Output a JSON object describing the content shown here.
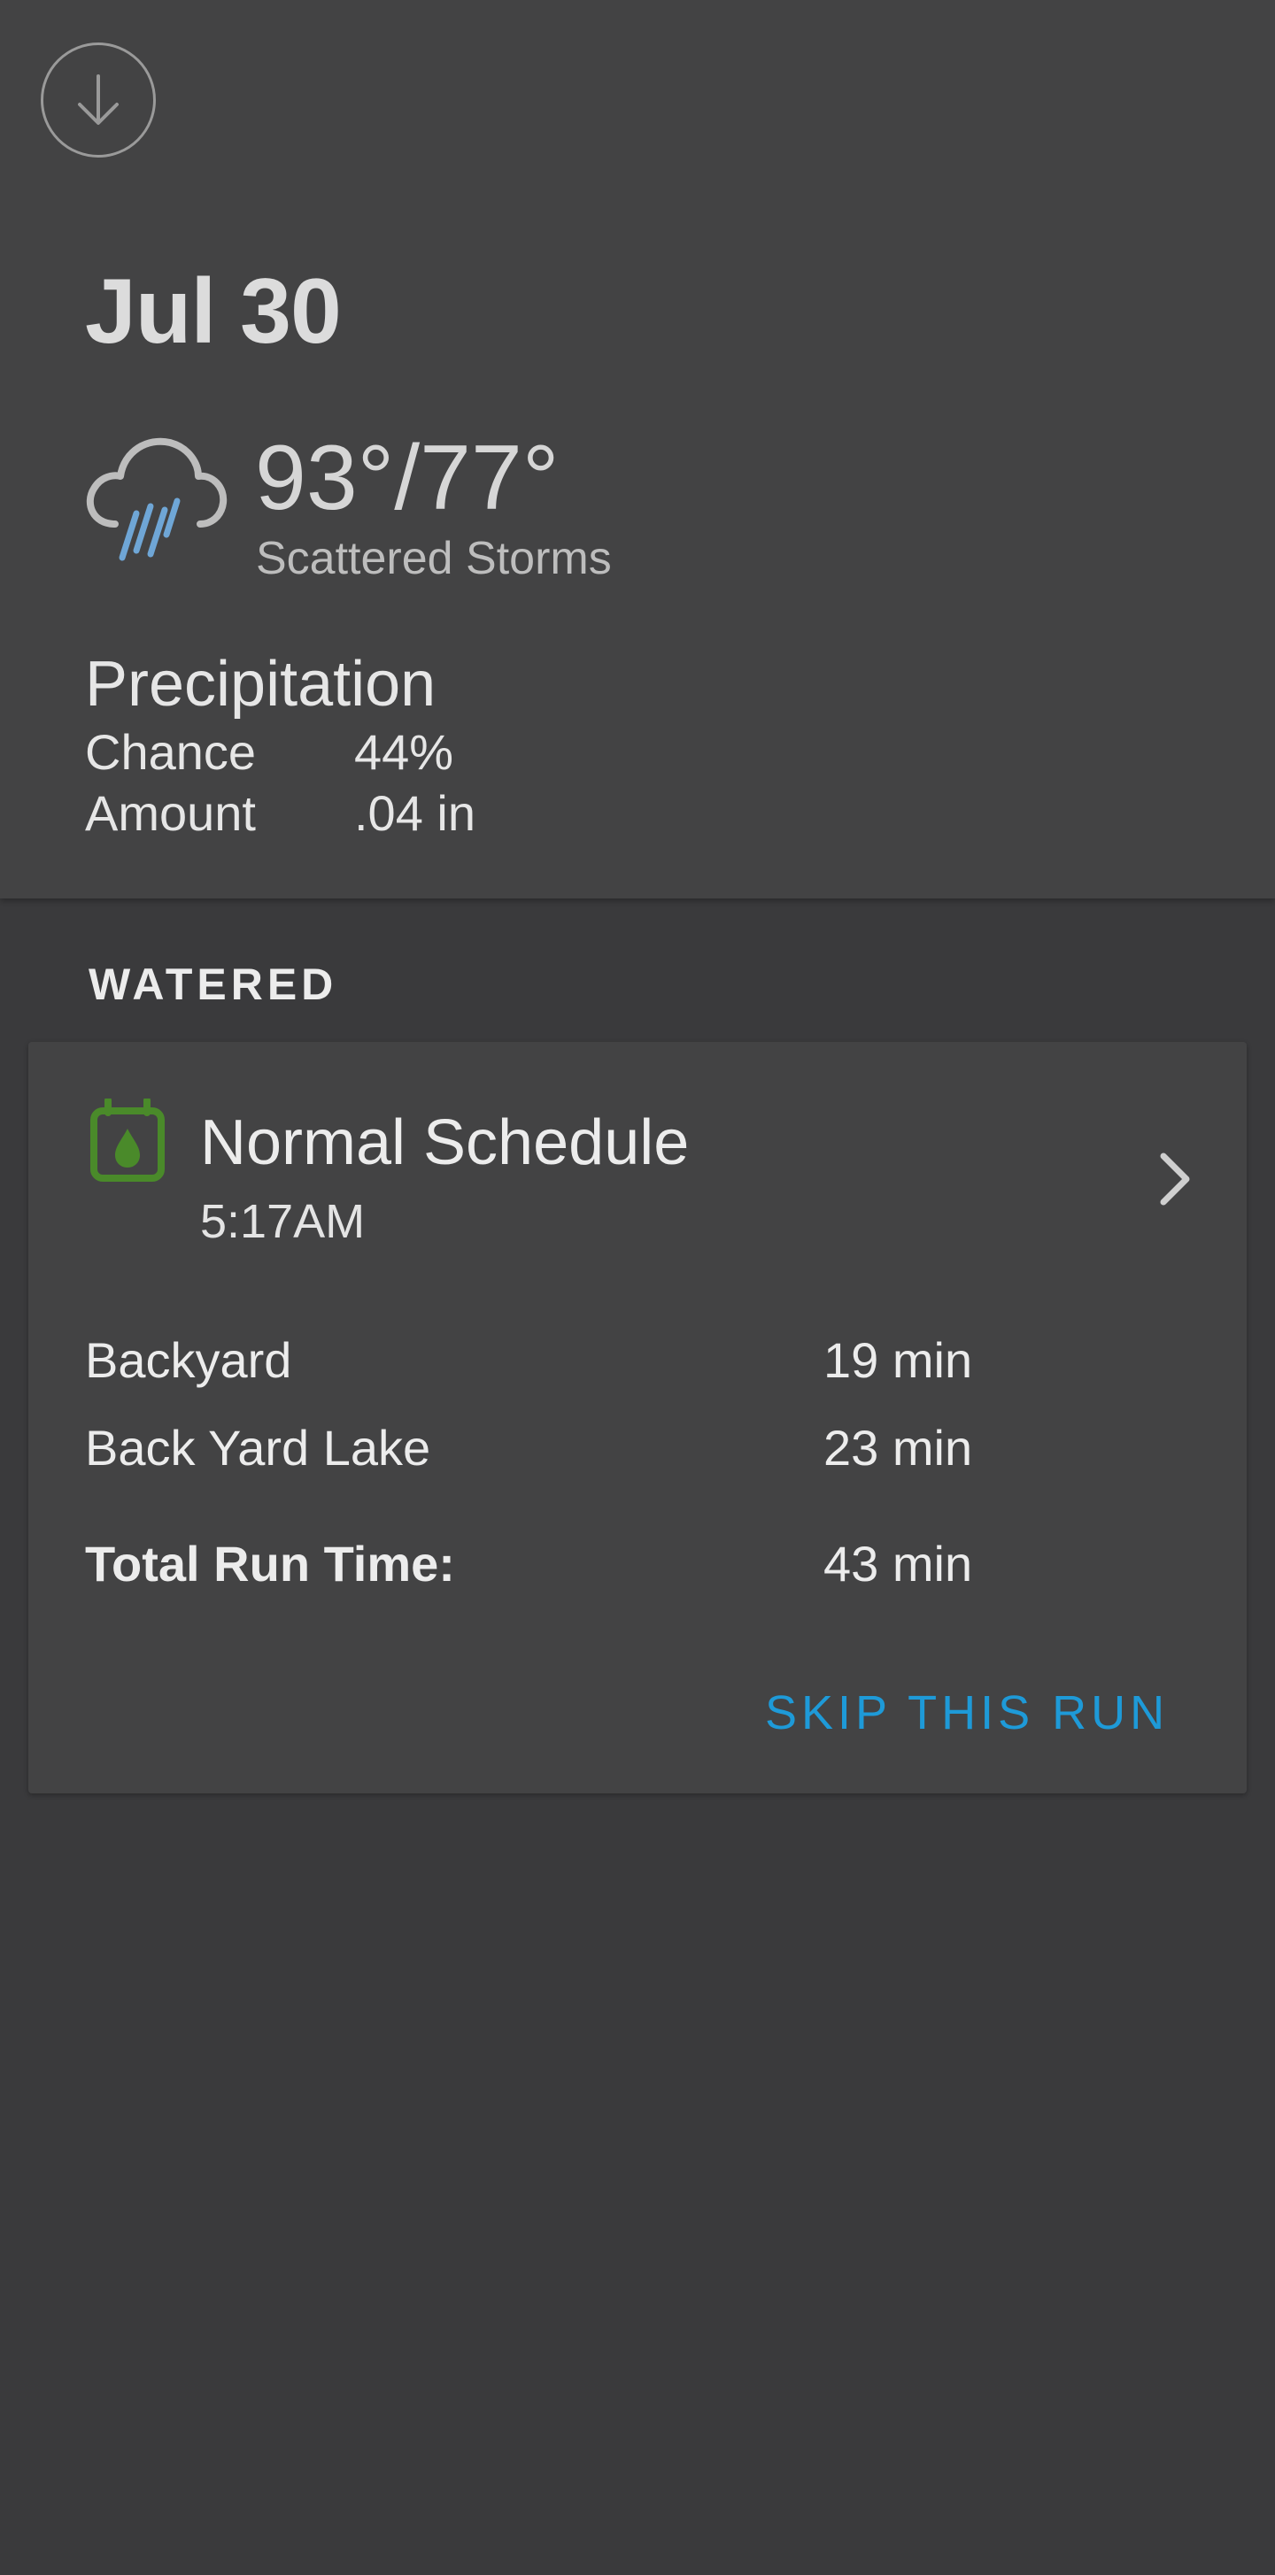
{
  "weather": {
    "date": "Jul 30",
    "temperature": "93°/77°",
    "conditions": "Scattered Storms",
    "icon": "rain-cloud-icon",
    "precipitation": {
      "title": "Precipitation",
      "chance_label": "Chance",
      "chance_value": "44%",
      "amount_label": "Amount",
      "amount_value": ".04 in"
    }
  },
  "watered": {
    "heading": "WATERED",
    "schedule_name": "Normal Schedule",
    "schedule_time": "5:17AM",
    "schedule_icon": "calendar-water-drop-icon",
    "zones": [
      {
        "name": "Backyard",
        "duration": "19 min"
      },
      {
        "name": "Back Yard Lake",
        "duration": "23 min"
      }
    ],
    "total_label": "Total Run Time:",
    "total_value": "43 min",
    "skip_label": "SKIP THIS RUN"
  },
  "colors": {
    "background": "#3a3a3c",
    "card": "#434344",
    "accent_blue": "#1e9ad8",
    "schedule_green": "#4a8a2a",
    "rain_blue": "#6fa6d6"
  }
}
